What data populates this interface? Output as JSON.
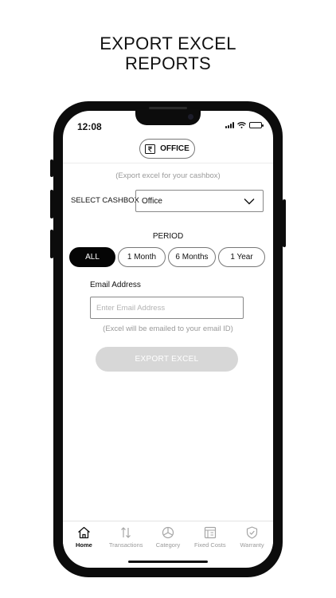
{
  "headline": {
    "line1": "EXPORT EXCEL",
    "line2": "REPORTS"
  },
  "status_bar": {
    "time": "12:08"
  },
  "header": {
    "cashbox_name": "OFFICE",
    "cashbox_icon": "rupee-icon"
  },
  "form": {
    "subtitle": "(Export excel for your cashbox)",
    "cashbox_label": "SELECT CASHBOX",
    "cashbox_selected": "Office",
    "period_label": "PERIOD",
    "period_options": [
      {
        "label": "ALL",
        "active": true
      },
      {
        "label": "1 Month",
        "active": false
      },
      {
        "label": "6 Months",
        "active": false
      },
      {
        "label": "1 Year",
        "active": false
      }
    ],
    "email_label": "Email Address",
    "email_value": "",
    "email_placeholder": "Enter Email Address",
    "email_note": "(Excel will be emailed to your email ID)",
    "export_label": "EXPORT EXCEL"
  },
  "bottom_nav": {
    "items": [
      {
        "label": "Home",
        "icon": "home-icon",
        "active": true
      },
      {
        "label": "Transactions",
        "icon": "transactions-icon",
        "active": false
      },
      {
        "label": "Category",
        "icon": "category-icon",
        "active": false
      },
      {
        "label": "Fixed Costs",
        "icon": "fixed-costs-icon",
        "active": false
      },
      {
        "label": "Warranty",
        "icon": "warranty-icon",
        "active": false
      }
    ]
  },
  "colors": {
    "accent": "#050505",
    "disabled_button": "#d7d7d7",
    "muted_text": "#9a9a9a"
  }
}
